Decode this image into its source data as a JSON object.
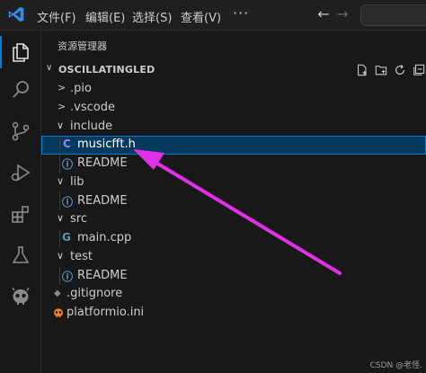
{
  "titlebar": {
    "menus": [
      "文件(F)",
      "编辑(E)",
      "选择(S)",
      "查看(V)"
    ],
    "more": "···",
    "back": "←",
    "forward": "→"
  },
  "activity_bar": {
    "items": [
      "explorer-icon",
      "search-icon",
      "source-control-icon",
      "run-debug-icon",
      "extensions-icon",
      "testing-icon",
      "platformio-icon"
    ],
    "active": "explorer-icon"
  },
  "sidebar": {
    "title": "资源管理器",
    "section": {
      "chevron": "∨",
      "name": "OSCILLATINGLED",
      "actions": [
        "new-file-icon",
        "new-folder-icon",
        "refresh-icon",
        "collapse-icon"
      ]
    },
    "tree": [
      {
        "label": ".pio",
        "type": "folder",
        "expanded": false,
        "chevron": ">"
      },
      {
        "label": ".vscode",
        "type": "folder",
        "expanded": false,
        "chevron": ">"
      },
      {
        "label": "include",
        "type": "folder",
        "expanded": true,
        "chevron": "∨"
      },
      {
        "label": "musicfft.h",
        "type": "file",
        "icon": "C",
        "selected": true
      },
      {
        "label": "README",
        "type": "file",
        "icon": "ⓘ"
      },
      {
        "label": "lib",
        "type": "folder",
        "expanded": true,
        "chevron": "∨"
      },
      {
        "label": "README",
        "type": "file",
        "icon": "ⓘ"
      },
      {
        "label": "src",
        "type": "folder",
        "expanded": true,
        "chevron": "∨"
      },
      {
        "label": "main.cpp",
        "type": "file",
        "icon": "G"
      },
      {
        "label": "test",
        "type": "folder",
        "expanded": true,
        "chevron": "∨"
      },
      {
        "label": "README",
        "type": "file",
        "icon": "ⓘ"
      },
      {
        "label": ".gitignore",
        "type": "file",
        "icon": "◆"
      },
      {
        "label": "platformio.ini",
        "type": "file",
        "icon": "👾"
      }
    ]
  },
  "watermark": "CSDN @老怪.",
  "colors": {
    "accent": "#0078d4",
    "selection": "#04395e",
    "annotation_arrow": "#e030e8"
  }
}
